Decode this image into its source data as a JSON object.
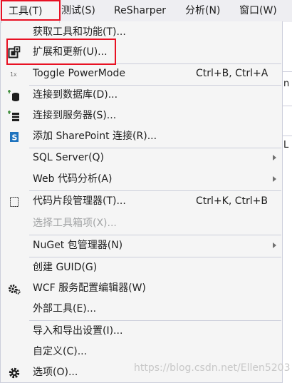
{
  "menubar": {
    "items": [
      "工具(T)",
      "测试(S)",
      "ReSharper",
      "分析(N)",
      "窗口(W)"
    ]
  },
  "background": {
    "letters": [
      "n",
      "L"
    ]
  },
  "menu": {
    "items": [
      {
        "label": "获取工具和功能(T)...",
        "shortcut": "",
        "submenu": false,
        "disabled": false,
        "icon": ""
      },
      {
        "label": "扩展和更新(U)...",
        "shortcut": "",
        "submenu": false,
        "disabled": false,
        "icon": "extensions-icon"
      },
      {
        "label": "Toggle PowerMode",
        "shortcut": "Ctrl+B, Ctrl+A",
        "submenu": false,
        "disabled": false,
        "icon": "powermode-icon"
      },
      {
        "label": "连接到数据库(D)...",
        "shortcut": "",
        "submenu": false,
        "disabled": false,
        "icon": "database-connect-icon"
      },
      {
        "label": "连接到服务器(S)...",
        "shortcut": "",
        "submenu": false,
        "disabled": false,
        "icon": "server-connect-icon"
      },
      {
        "label": "添加 SharePoint 连接(R)...",
        "shortcut": "",
        "submenu": false,
        "disabled": false,
        "icon": "sharepoint-icon"
      },
      {
        "label": "SQL Server(Q)",
        "shortcut": "",
        "submenu": true,
        "disabled": false,
        "icon": ""
      },
      {
        "label": "Web 代码分析(A)",
        "shortcut": "",
        "submenu": true,
        "disabled": false,
        "icon": ""
      },
      {
        "label": "代码片段管理器(T)...",
        "shortcut": "Ctrl+K, Ctrl+B",
        "submenu": false,
        "disabled": false,
        "icon": "snippet-icon"
      },
      {
        "label": "选择工具箱项(X)...",
        "shortcut": "",
        "submenu": false,
        "disabled": true,
        "icon": ""
      },
      {
        "label": "NuGet 包管理器(N)",
        "shortcut": "",
        "submenu": true,
        "disabled": false,
        "icon": ""
      },
      {
        "label": "创建 GUID(G)",
        "shortcut": "",
        "submenu": false,
        "disabled": false,
        "icon": ""
      },
      {
        "label": "WCF 服务配置编辑器(W)",
        "shortcut": "",
        "submenu": false,
        "disabled": false,
        "icon": "wcf-gear-icon"
      },
      {
        "label": "外部工具(E)...",
        "shortcut": "",
        "submenu": false,
        "disabled": false,
        "icon": ""
      },
      {
        "label": "导入和导出设置(I)...",
        "shortcut": "",
        "submenu": false,
        "disabled": false,
        "icon": ""
      },
      {
        "label": "自定义(C)...",
        "shortcut": "",
        "submenu": false,
        "disabled": false,
        "icon": ""
      },
      {
        "label": "选项(O)...",
        "shortcut": "",
        "submenu": false,
        "disabled": false,
        "icon": "gear-icon"
      }
    ]
  },
  "watermark": "https://blog.csdn.net/Ellen5203",
  "colors": {
    "highlight_border": "#e81123",
    "menu_background": "#f5f5f5",
    "disabled_text": "#a2a4a5",
    "icon_blue": "#1e73be",
    "icon_green": "#388a34"
  }
}
